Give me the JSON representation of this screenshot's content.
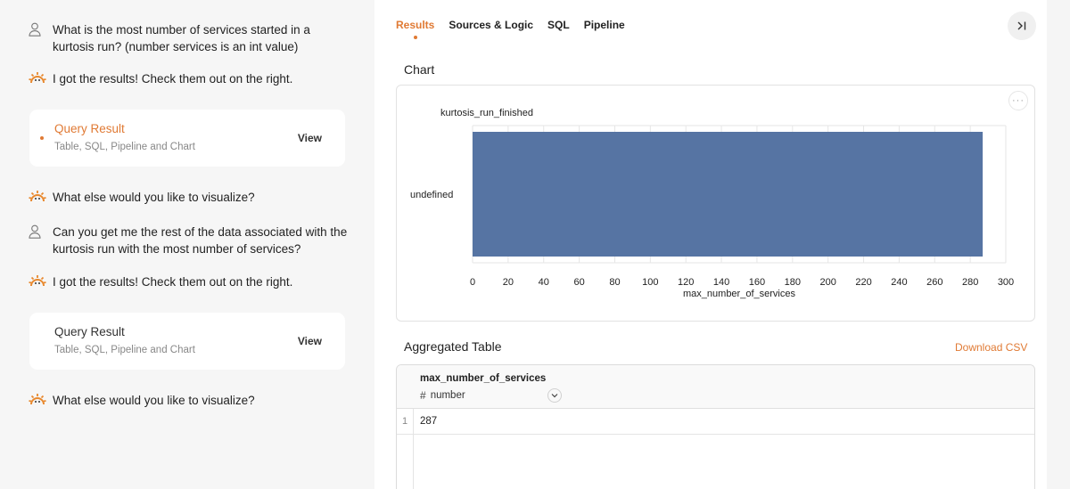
{
  "chat": {
    "messages": [
      {
        "role": "user",
        "icon": "user-icon",
        "text": "What is the most number of services started in a kurtosis run? (number services is an int value)"
      },
      {
        "role": "assistant",
        "icon": "sun-logo-icon",
        "text": "I got the results! Check them out on the right."
      },
      {
        "role": "assistant",
        "icon": "sun-logo-icon",
        "text": "What else would you like to visualize?"
      },
      {
        "role": "user",
        "icon": "user-icon",
        "text": "Can you get me the rest of the data associated with the kurtosis run with the most number of services?"
      },
      {
        "role": "assistant",
        "icon": "sun-logo-icon",
        "text": "I got the results! Check them out on the right."
      },
      {
        "role": "assistant",
        "icon": "sun-logo-icon",
        "text": "What else would you like to visualize?"
      }
    ],
    "cards": [
      {
        "title": "Query Result",
        "subtitle": "Table, SQL, Pipeline and Chart",
        "action": "View",
        "active": true
      },
      {
        "title": "Query Result",
        "subtitle": "Table, SQL, Pipeline and Chart",
        "action": "View",
        "active": false
      }
    ]
  },
  "results": {
    "tabs": [
      {
        "label": "Results",
        "active": true
      },
      {
        "label": "Sources & Logic",
        "active": false
      },
      {
        "label": "SQL",
        "active": false
      },
      {
        "label": "Pipeline",
        "active": false
      }
    ],
    "collapse_icon": "collapse-right-icon",
    "chart_section_title": "Chart",
    "more_icon": "more-horizontal-icon",
    "table_section_title": "Aggregated Table",
    "download_label": "Download CSV",
    "table": {
      "column": {
        "name": "max_number_of_services",
        "type": "number",
        "type_icon": "hash-icon",
        "sort_icon": "chevron-down-icon"
      },
      "rows": [
        {
          "index": "1",
          "value": "287"
        }
      ]
    }
  },
  "colors": {
    "accent": "#e07a34",
    "bar": "#5674a3",
    "grid": "#e6e6e6"
  },
  "chart_data": {
    "type": "bar",
    "orientation": "horizontal",
    "title": "",
    "legend": "kurtosis_run_finished",
    "categories": [
      "undefined"
    ],
    "series": [
      {
        "name": "kurtosis_run_finished",
        "values": [
          287
        ]
      }
    ],
    "xlabel": "max_number_of_services",
    "ylabel": "",
    "xlim": [
      0,
      300
    ],
    "xticks": [
      0,
      20,
      40,
      60,
      80,
      100,
      120,
      140,
      160,
      180,
      200,
      220,
      240,
      260,
      280,
      300
    ],
    "grid": true
  }
}
